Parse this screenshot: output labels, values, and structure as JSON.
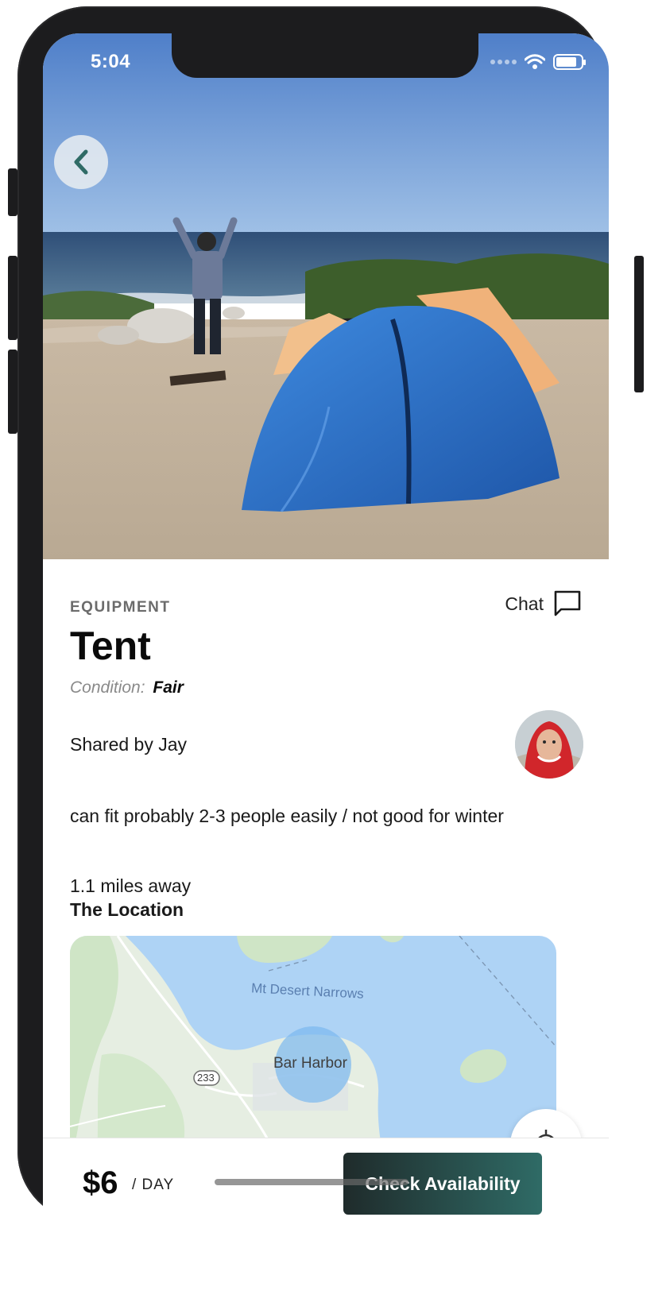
{
  "status_bar": {
    "time": "5:04"
  },
  "item": {
    "category": "EQUIPMENT",
    "title": "Tent",
    "condition_label": "Condition:",
    "condition_value": "Fair",
    "shared_by": "Shared by Jay",
    "description": "can fit probably 2-3 people easily / not good for winter",
    "distance_value": "1.1",
    "distance_unit": "miles away",
    "location_heading": "The Location"
  },
  "chat": {
    "label": "Chat"
  },
  "map": {
    "water_label": "Mt Desert Narrows",
    "town_label": "Bar Harbor",
    "route_label": "233"
  },
  "booking": {
    "price": "$6",
    "unit": "/ DAY",
    "cta_label": "Check Availability"
  },
  "icons": {
    "back": "chevron-left-icon",
    "chat": "chat-bubble-icon",
    "wifi": "wifi-icon",
    "battery": "battery-icon"
  },
  "colors": {
    "accent": "#2f6b66",
    "button_dark": "#1f2b2b",
    "map_water": "#aed3f5",
    "map_land": "#e8efe4"
  }
}
